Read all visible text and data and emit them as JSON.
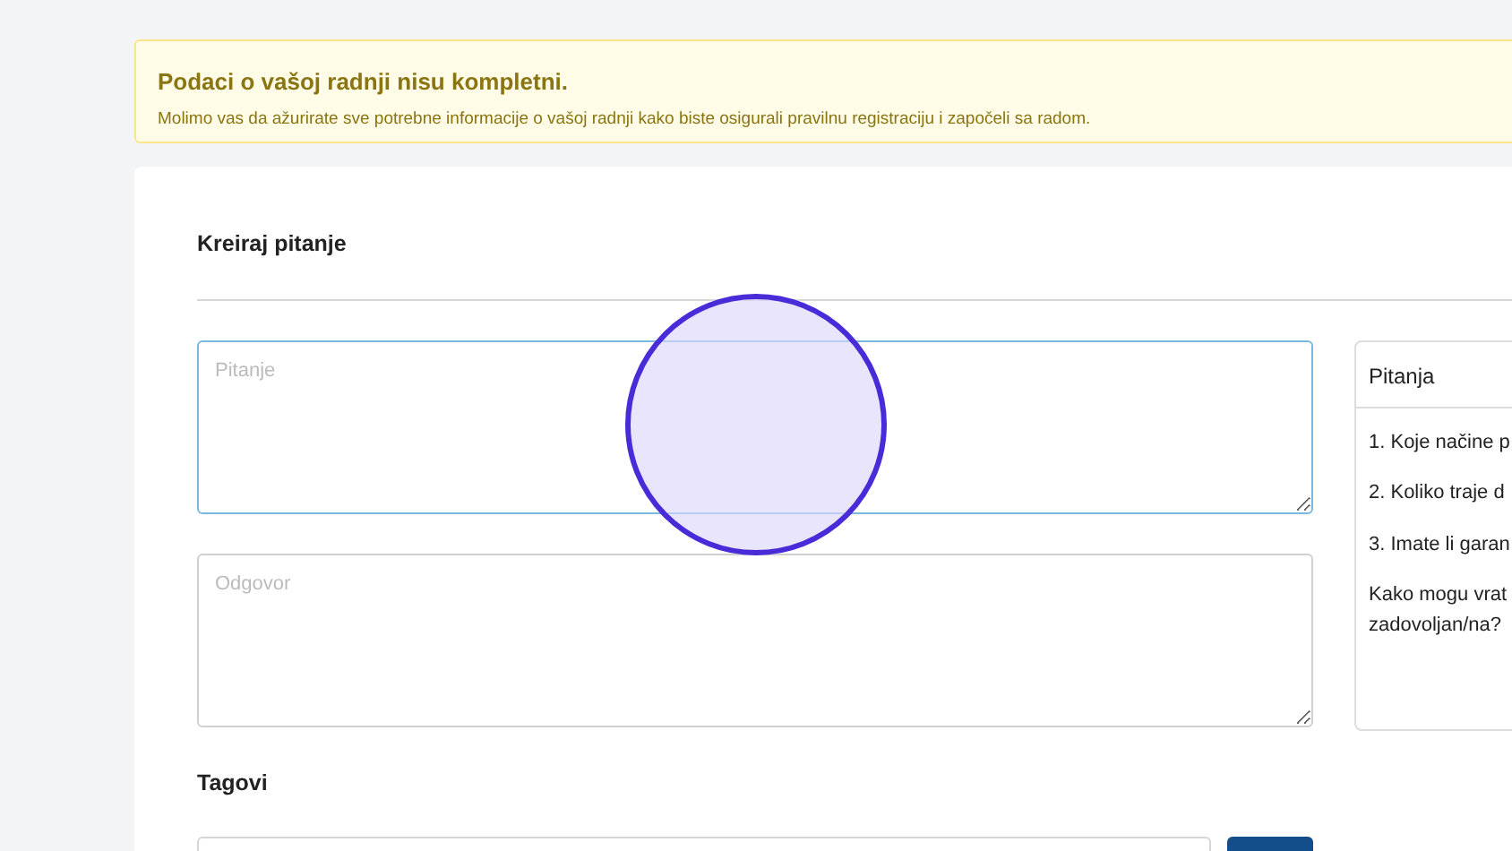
{
  "alert": {
    "title": "Podaci o vašoj radnji nisu kompletni.",
    "message": "Molimo vas da ažurirate sve potrebne informacije o vašoj radnji kako biste osigurali pravilnu registraciju i započeli sa radom."
  },
  "form": {
    "title": "Kreiraj pitanje",
    "fields": [
      {
        "placeholder": "Pitanje",
        "focused": true
      },
      {
        "placeholder": "Odgovor",
        "focused": false
      }
    ],
    "tags_label": "Tagovi"
  },
  "questions_panel": {
    "title": "Pitanja",
    "items": [
      {
        "lines": [
          "1. Koje načine p"
        ]
      },
      {
        "lines": [
          "2. Koliko traje d"
        ]
      },
      {
        "lines": [
          "3. Imate li garan"
        ]
      },
      {
        "lines": [
          "Kako mogu vrat",
          "zadovoljan/na?"
        ]
      }
    ]
  }
}
